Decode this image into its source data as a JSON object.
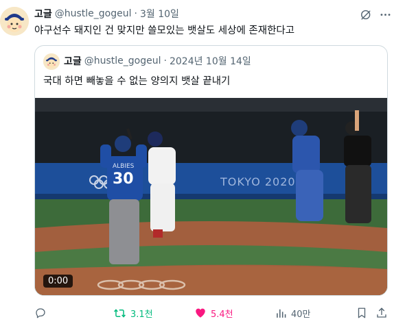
{
  "tweet": {
    "name": "고글",
    "handle": "@hustle_gogeul",
    "separator": "·",
    "date": "3월 10일",
    "text": "야구선수 돼지인 건 맞지만 쓸모있는 뱃살도 세상에 존재한다고"
  },
  "quote": {
    "name": "고글",
    "handle": "@hustle_gogeul",
    "separator": "·",
    "date": "2024년 10월 14일",
    "text": "국대 하면 빼놓을 수 없는 양의지 뱃살 끝내기",
    "video": {
      "duration": "0:00",
      "scoreboard_text": "TOKYO 2020",
      "player_name": "ALBIES",
      "player_number": "30"
    }
  },
  "actions": {
    "reply_count": "",
    "retweet_count": "3.1천",
    "like_count": "5.4천",
    "views_count": "40만"
  },
  "colors": {
    "text_primary": "#0f1419",
    "text_secondary": "#536471",
    "retweet_green": "#00ba7c",
    "like_pink": "#f91880",
    "border": "#cfd9de"
  }
}
